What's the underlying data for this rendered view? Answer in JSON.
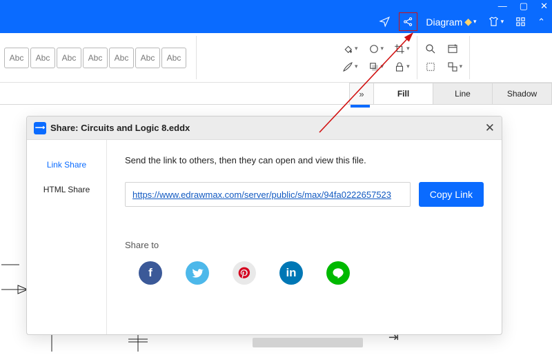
{
  "titlebar": {
    "diagram_label": "Diagram"
  },
  "abc_styles": [
    "Abc",
    "Abc",
    "Abc",
    "Abc",
    "Abc",
    "Abc",
    "Abc"
  ],
  "side_tabs": {
    "fill": "Fill",
    "line": "Line",
    "shadow": "Shadow"
  },
  "collapse_glyph": "»",
  "dialog": {
    "title": "Share: Circuits and Logic 8.eddx",
    "sidebar": {
      "link_share": "Link Share",
      "html_share": "HTML Share"
    },
    "description": "Send the link to others, then they can open and view this file.",
    "link_url": "https://www.edrawmax.com/server/public/s/max/94fa0222657523",
    "copy_button": "Copy Link",
    "share_to_label": "Share to",
    "socials": {
      "fb": "f",
      "tw": "",
      "pin": "",
      "li": "in",
      "line": ""
    }
  }
}
